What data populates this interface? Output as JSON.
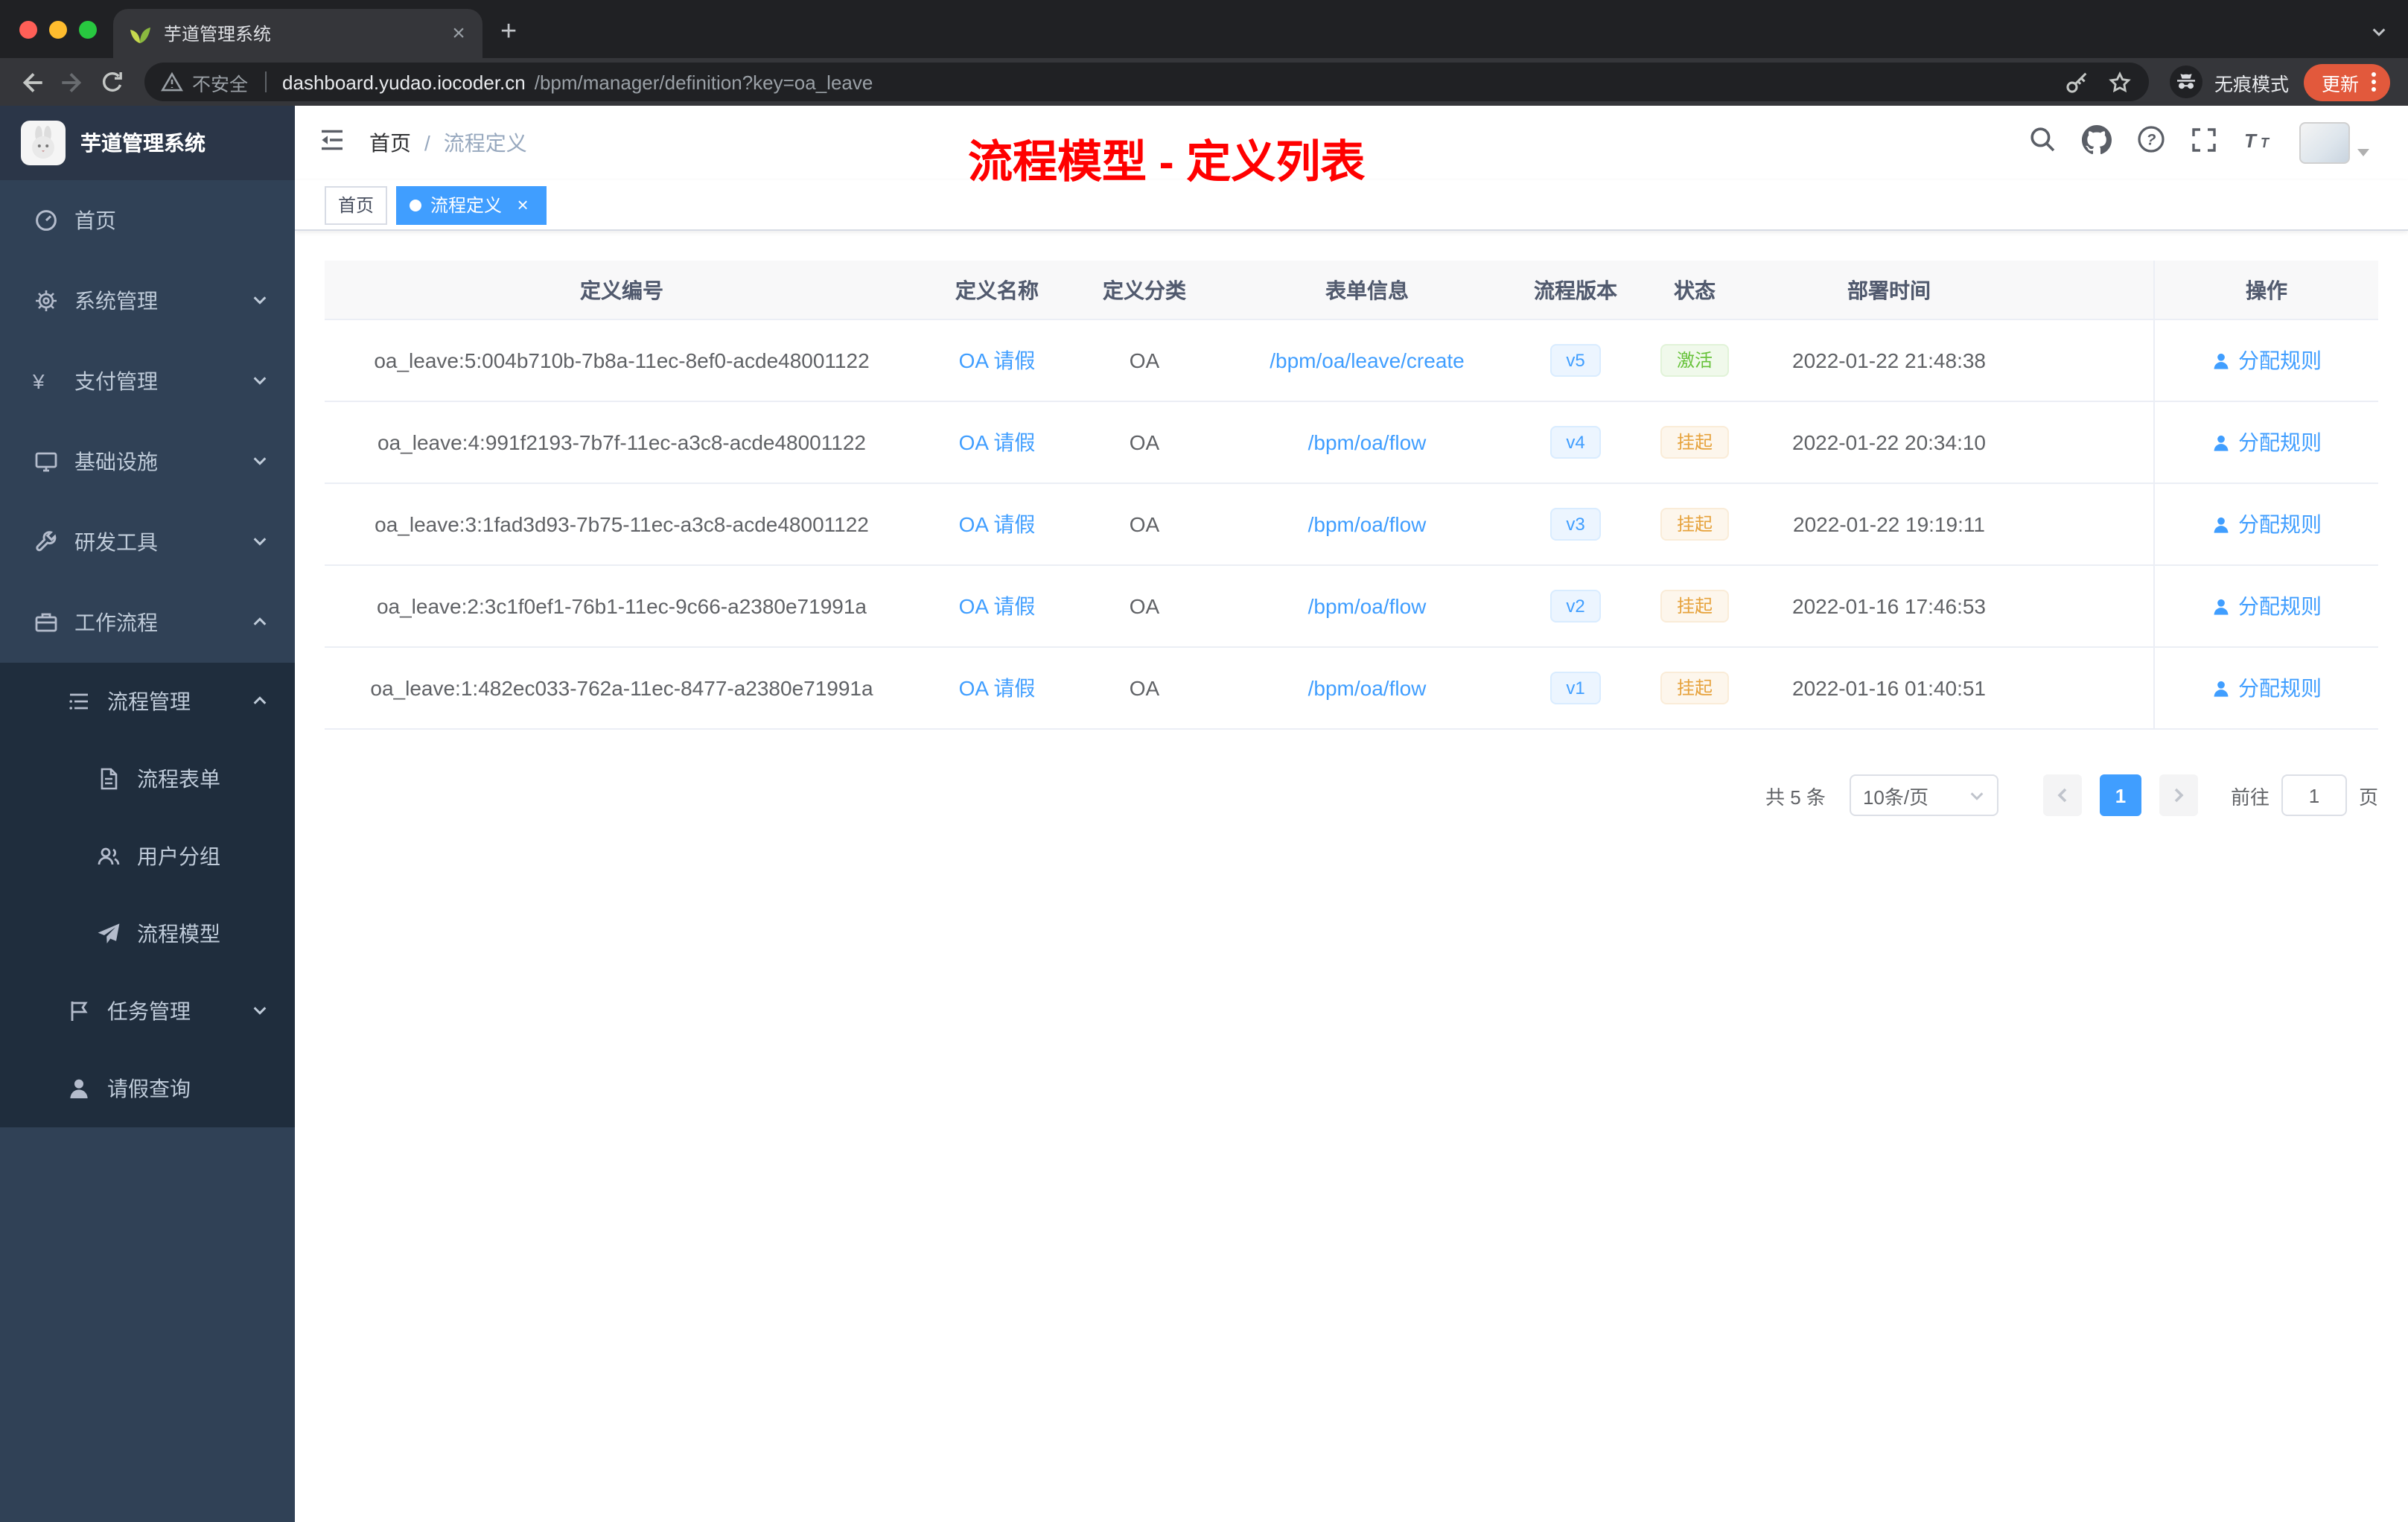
{
  "browser": {
    "tab_title": "芋道管理系统",
    "security_label": "不安全",
    "url_host": "dashboard.yudao.iocoder.cn",
    "url_path": "/bpm/manager/definition?key=oa_leave",
    "incognito_label": "无痕模式",
    "update_label": "更新"
  },
  "glyphs": {
    "close": "×",
    "plus": "+",
    "yen": "¥"
  },
  "sidebar": {
    "title": "芋道管理系统",
    "items": [
      {
        "label": "首页"
      },
      {
        "label": "系统管理"
      },
      {
        "label": "支付管理"
      },
      {
        "label": "基础设施"
      },
      {
        "label": "研发工具"
      },
      {
        "label": "工作流程"
      },
      {
        "label": "流程管理"
      },
      {
        "label": "流程表单"
      },
      {
        "label": "用户分组"
      },
      {
        "label": "流程模型"
      },
      {
        "label": "任务管理"
      },
      {
        "label": "请假查询"
      }
    ]
  },
  "navbar": {
    "breadcrumb": [
      "首页",
      "流程定义"
    ],
    "separator": "/"
  },
  "annotation": "流程模型 - 定义列表",
  "tags": [
    {
      "label": "首页"
    },
    {
      "label": "流程定义"
    }
  ],
  "table": {
    "columns": [
      "定义编号",
      "定义名称",
      "定义分类",
      "表单信息",
      "流程版本",
      "状态",
      "部署时间",
      "操作"
    ],
    "rows": [
      {
        "id": "oa_leave:5:004b710b-7b8a-11ec-8ef0-acde48001122",
        "name": "OA 请假",
        "category": "OA",
        "form": "/bpm/oa/leave/create",
        "version": "v5",
        "status": "激活",
        "time": "2022-01-22 21:48:38",
        "action": "分配规则"
      },
      {
        "id": "oa_leave:4:991f2193-7b7f-11ec-a3c8-acde48001122",
        "name": "OA 请假",
        "category": "OA",
        "form": "/bpm/oa/flow",
        "version": "v4",
        "status": "挂起",
        "time": "2022-01-22 20:34:10",
        "action": "分配规则"
      },
      {
        "id": "oa_leave:3:1fad3d93-7b75-11ec-a3c8-acde48001122",
        "name": "OA 请假",
        "category": "OA",
        "form": "/bpm/oa/flow",
        "version": "v3",
        "status": "挂起",
        "time": "2022-01-22 19:19:11",
        "action": "分配规则"
      },
      {
        "id": "oa_leave:2:3c1f0ef1-76b1-11ec-9c66-a2380e71991a",
        "name": "OA 请假",
        "category": "OA",
        "form": "/bpm/oa/flow",
        "version": "v2",
        "status": "挂起",
        "time": "2022-01-16 17:46:53",
        "action": "分配规则"
      },
      {
        "id": "oa_leave:1:482ec033-762a-11ec-8477-a2380e71991a",
        "name": "OA 请假",
        "category": "OA",
        "form": "/bpm/oa/flow",
        "version": "v1",
        "status": "挂起",
        "time": "2022-01-16 01:40:51",
        "action": "分配规则"
      }
    ]
  },
  "pagination": {
    "total": "共 5 条",
    "page_size": "10条/页",
    "page": "1",
    "goto_label": "前往",
    "goto_value": "1",
    "unit": "页"
  },
  "colors": {
    "accent": "#409EFF",
    "success": "#67C23A",
    "warning": "#E6A23C",
    "annotation_red": "#FF0000",
    "sidebar_bg": "#304156",
    "submenu_bg": "#1F2D3D",
    "active_tag": "#409EFF"
  }
}
